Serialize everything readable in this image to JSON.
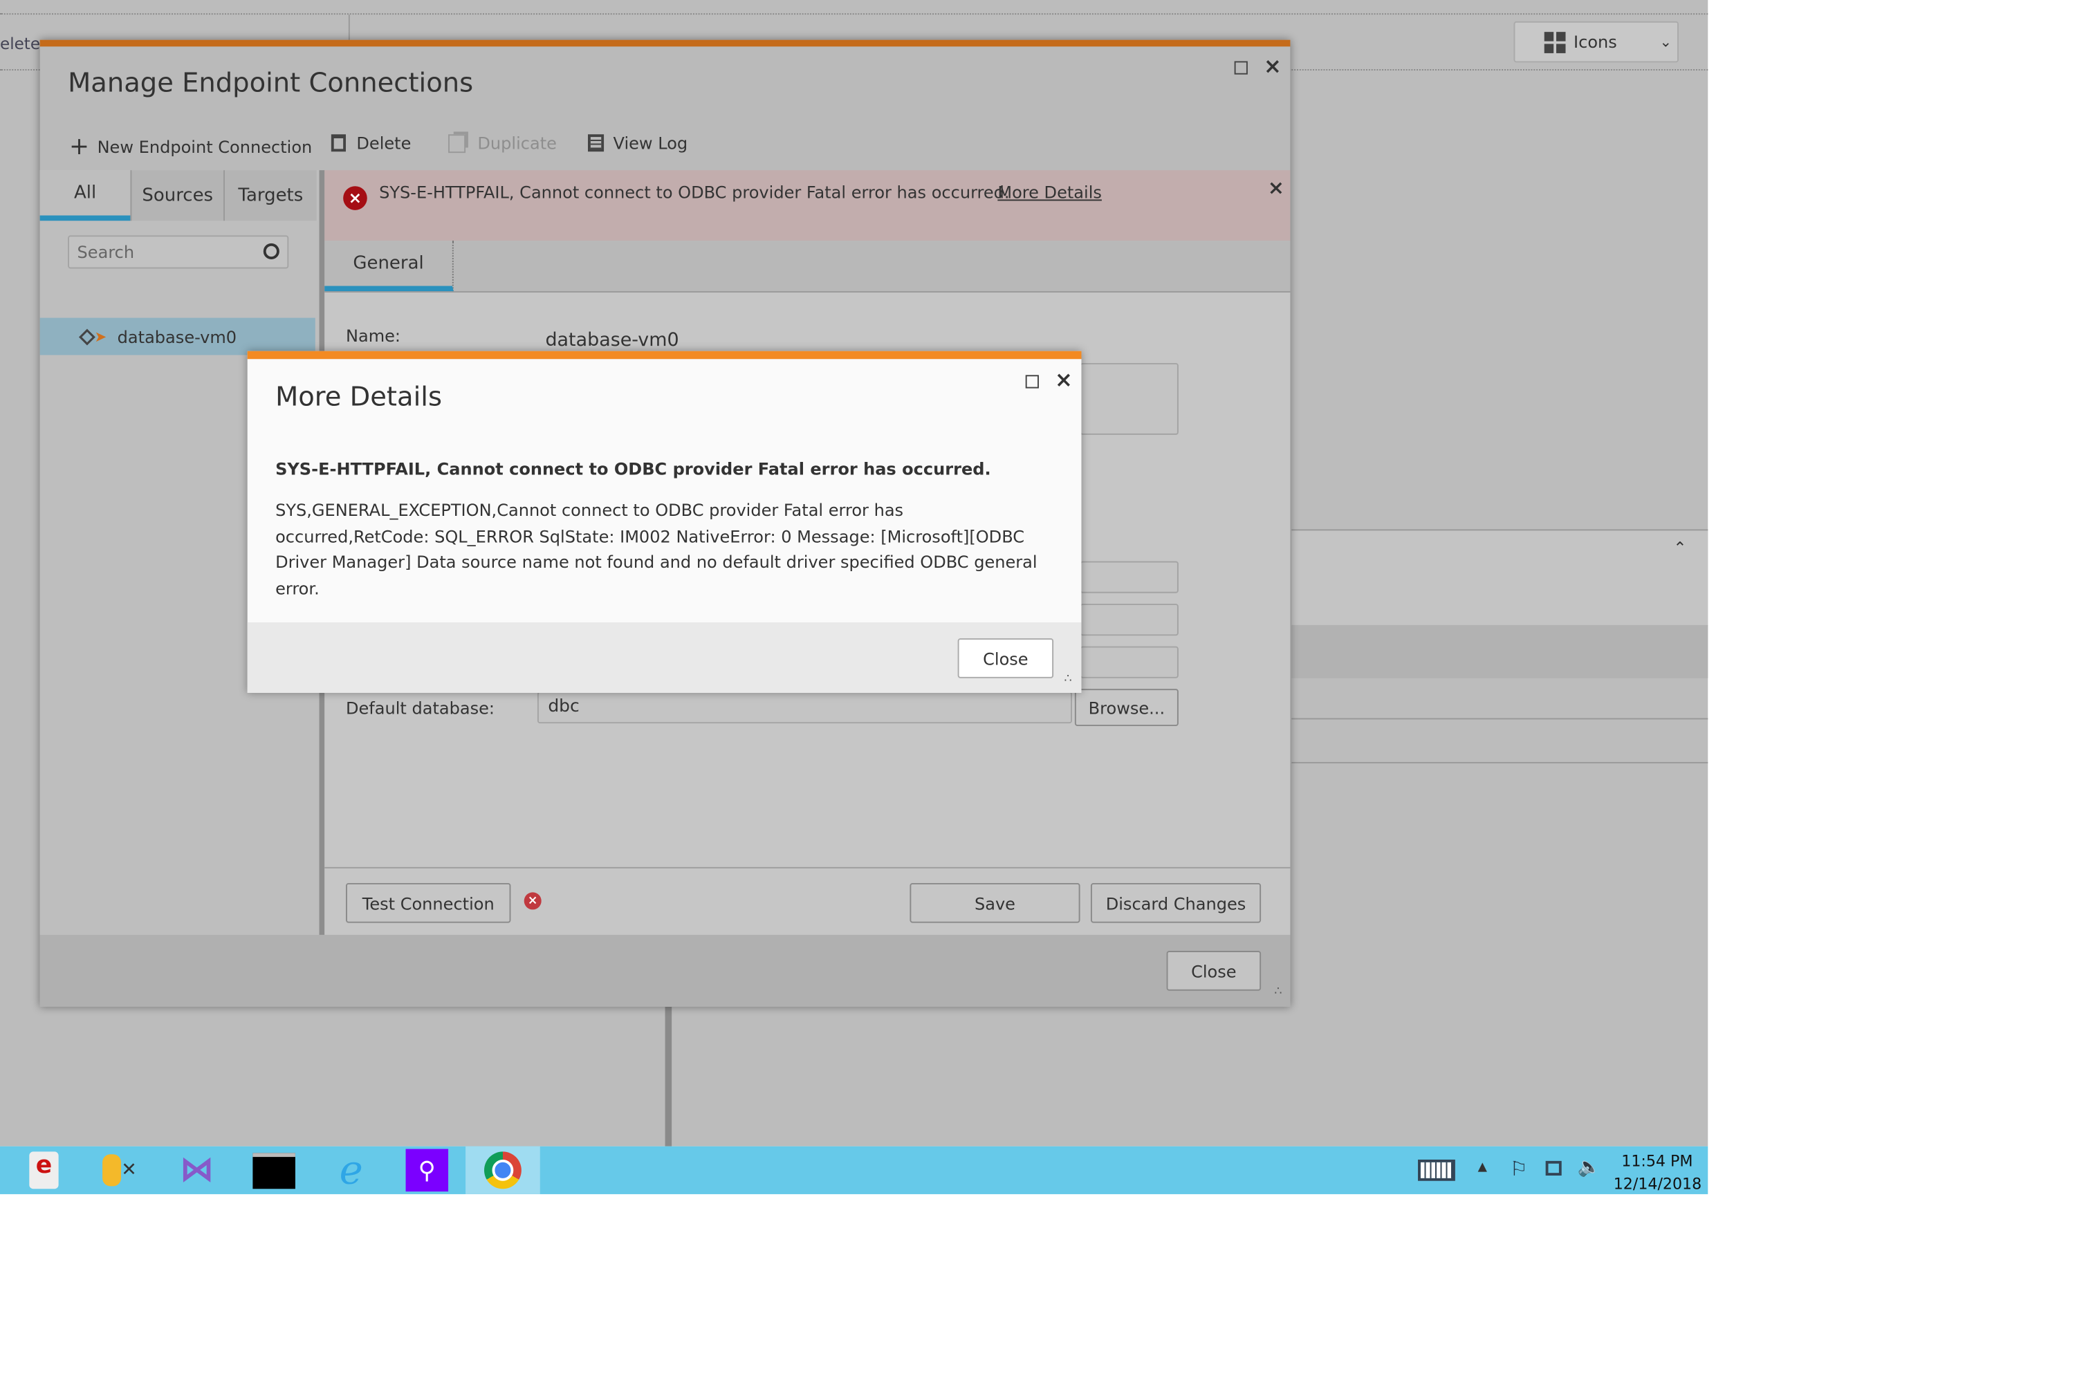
{
  "background_app": {
    "toolbar_fragment": "elete",
    "view_dropdown": {
      "label": "Icons",
      "icon": "grid-icon"
    }
  },
  "manage_dialog": {
    "title": "Manage Endpoint Connections",
    "toolbar": {
      "new_label": "New Endpoint Connection",
      "delete_label": "Delete",
      "duplicate_label": "Duplicate",
      "view_log_label": "View Log"
    },
    "tabs": [
      {
        "label": "All",
        "active": true
      },
      {
        "label": "Sources"
      },
      {
        "label": "Targets"
      }
    ],
    "search_placeholder": "Search",
    "endpoints": [
      {
        "label": "database-vm0",
        "selected": true
      }
    ],
    "error_banner": {
      "message": "SYS-E-HTTPFAIL, Cannot connect to ODBC provider Fatal error has occurred.",
      "link": "More Details"
    },
    "detail_tabs": [
      {
        "label": "General",
        "active": true
      }
    ],
    "form": {
      "name_label": "Name:",
      "name_value": "database-vm0",
      "default_db_label": "Default database:",
      "default_db_value": "dbc",
      "browse_label": "Browse..."
    },
    "test_connection_label": "Test Connection",
    "save_label": "Save",
    "discard_label": "Discard Changes",
    "close_label": "Close"
  },
  "more_details_dialog": {
    "title": "More Details",
    "headline": "SYS-E-HTTPFAIL, Cannot connect to ODBC provider Fatal error has occurred.",
    "body": "SYS,GENERAL_EXCEPTION,Cannot connect to ODBC provider Fatal error has occurred,RetCode: SQL_ERROR SqlState: IM002 NativeError: 0 Message: [Microsoft][ODBC Driver Manager] Data source name not found and no default driver specified ODBC general error.",
    "close_label": "Close"
  },
  "taskbar": {
    "apps": [
      "replicate-app-icon",
      "admin-tools-icon",
      "visual-studio-icon",
      "terminal-icon",
      "internet-explorer-icon",
      "search-app-icon",
      "chrome-icon"
    ],
    "time": "11:54 PM",
    "date": "12/14/2018"
  },
  "colors": {
    "accent_orange": "#f38a22",
    "tab_blue": "#2a91bd",
    "error_red": "#a50e14",
    "taskbar": "#66c9e9"
  }
}
